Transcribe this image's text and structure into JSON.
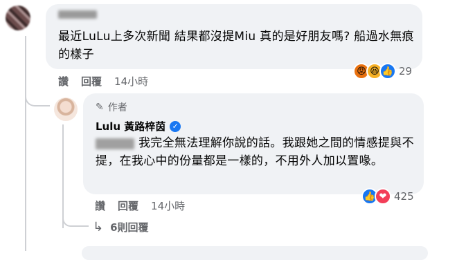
{
  "comment1": {
    "text": "最近LuLu上多次新聞 結果都沒提Miu 真的是好朋友嗎? 船過水無痕的樣子",
    "actions": {
      "like": "讚",
      "reply": "回覆",
      "time": "14小時"
    },
    "reactions": {
      "icons": [
        "angry-icon",
        "haha-icon",
        "like-icon"
      ],
      "count": "29"
    }
  },
  "reply1": {
    "badge": "作者",
    "author": "Lulu 黃路梓茵",
    "text": "我完全無法理解你說的話。我跟她之間的情感提與不提，在我心中的份量都是一樣的，不用外人加以置喙。",
    "actions": {
      "like": "讚",
      "reply": "回覆",
      "time": "14小時"
    },
    "reactions": {
      "icons": [
        "like-icon",
        "love-icon"
      ],
      "count": "425"
    }
  },
  "more_replies": {
    "label": "6則回覆"
  }
}
